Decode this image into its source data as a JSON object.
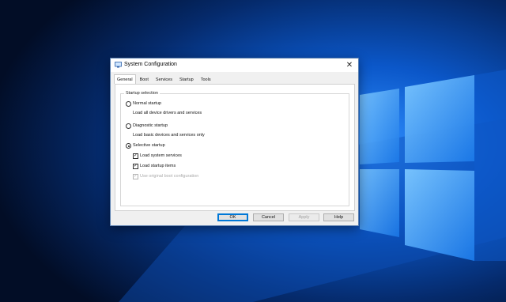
{
  "window": {
    "title": "System Configuration",
    "close_glyph": "✕",
    "app_icon": "system-config-icon"
  },
  "tabs": [
    {
      "label": "General",
      "active": true
    },
    {
      "label": "Boot",
      "active": false
    },
    {
      "label": "Services",
      "active": false
    },
    {
      "label": "Startup",
      "active": false
    },
    {
      "label": "Tools",
      "active": false
    }
  ],
  "startup": {
    "group_title": "Startup selection",
    "normal": {
      "label": "Normal startup",
      "desc": "Load all device drivers and services",
      "selected": false
    },
    "diagnostic": {
      "label": "Diagnostic startup",
      "desc": "Load basic devices and services only",
      "selected": false
    },
    "selective": {
      "label": "Selective startup",
      "selected": true,
      "options": [
        {
          "label": "Load system services",
          "checked": true,
          "enabled": true
        },
        {
          "label": "Load startup items",
          "checked": true,
          "enabled": true
        },
        {
          "label": "Use original boot configuration",
          "checked": true,
          "enabled": false
        }
      ]
    }
  },
  "buttons": {
    "ok": "OK",
    "cancel": "Cancel",
    "apply": "Apply",
    "help": "Help"
  },
  "colors": {
    "desktop_dark": "#0a2a5c",
    "desktop_light": "#4ba3ff",
    "accent": "#0078d7"
  }
}
